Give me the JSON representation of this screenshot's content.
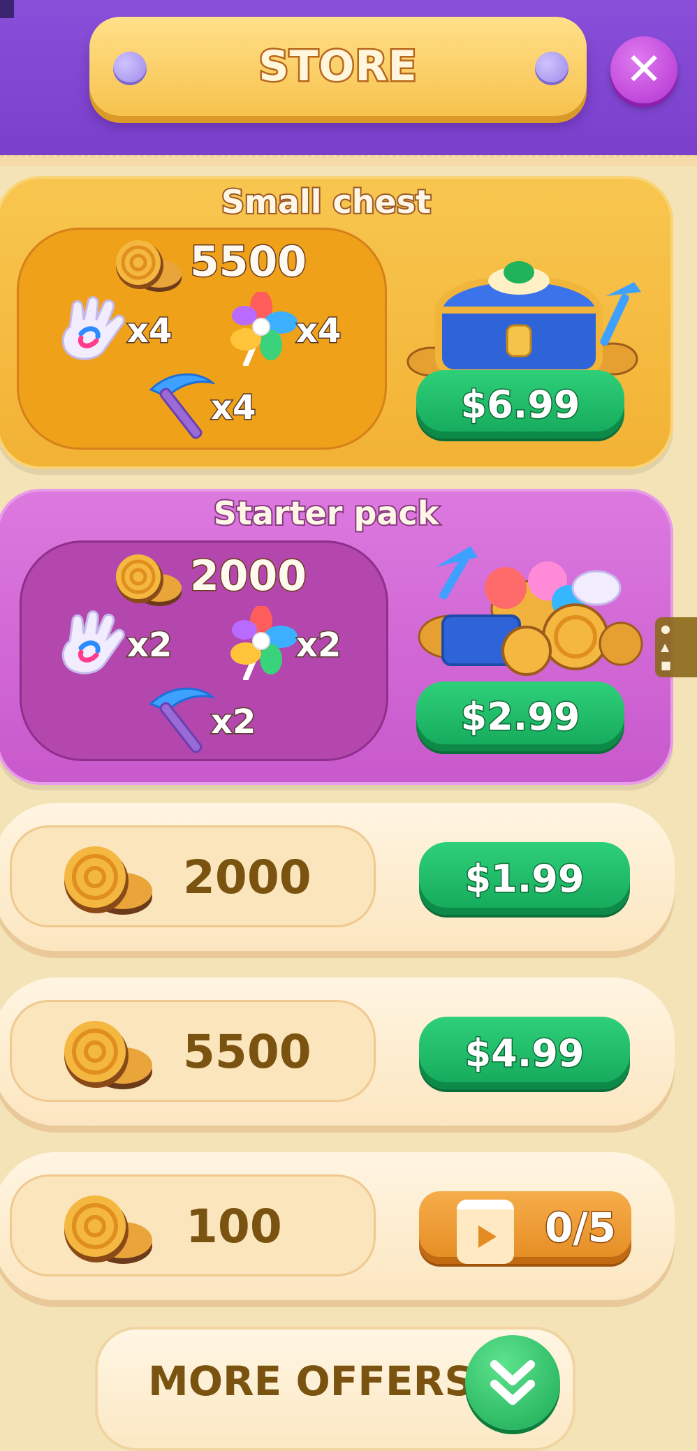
{
  "header": {
    "title": "STORE"
  },
  "packs": [
    {
      "title": "Small chest",
      "coins": "5500",
      "items": [
        {
          "icon": "glove-icon",
          "qty": "x4"
        },
        {
          "icon": "pinwheel-icon",
          "qty": "x4"
        },
        {
          "icon": "pickaxe-icon",
          "qty": "x4"
        }
      ],
      "price": "$6.99",
      "art": "treasure-chest-icon"
    },
    {
      "title": "Starter pack",
      "coins": "2000",
      "items": [
        {
          "icon": "glove-icon",
          "qty": "x2"
        },
        {
          "icon": "pinwheel-icon",
          "qty": "x2"
        },
        {
          "icon": "pickaxe-icon",
          "qty": "x2"
        }
      ],
      "price": "$2.99",
      "art": "coin-pile-icon"
    }
  ],
  "offers": [
    {
      "coins": "2000",
      "price": "$1.99"
    },
    {
      "coins": "5500",
      "price": "$4.99"
    },
    {
      "coins": "100",
      "watch_progress": "0/5"
    }
  ],
  "more_offers": {
    "label": "MORE OFFERS!"
  },
  "colors": {
    "header": "#7a40cc",
    "background": "#f5e3b8",
    "gold_pack": "#f2b234",
    "purple_pack": "#c859cc",
    "buy_button": "#14a85a",
    "video_button": "#e48b22"
  }
}
